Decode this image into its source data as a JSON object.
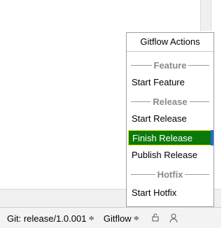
{
  "popup": {
    "title": "Gitflow Actions",
    "sections": [
      {
        "header": "Feature",
        "items": [
          "Start Feature"
        ]
      },
      {
        "header": "Release",
        "items": [
          "Start Release",
          "Finish Release",
          "Publish Release"
        ]
      },
      {
        "header": "Hotfix",
        "items": [
          "Start Hotfix"
        ]
      }
    ],
    "highlighted_item": "Finish Release"
  },
  "status_bar": {
    "git_branch": "Git: release/1.0.001",
    "gitflow": "Gitflow",
    "caret_glyph": "≑",
    "lock_icon": "lock-icon",
    "user_icon": "user-icon"
  },
  "colors": {
    "highlight_bg": "#0b7a0b",
    "highlight_border": "#e8e800",
    "highlight_accent": "#1e6fd0",
    "separator_text": "#8a8a8a"
  }
}
